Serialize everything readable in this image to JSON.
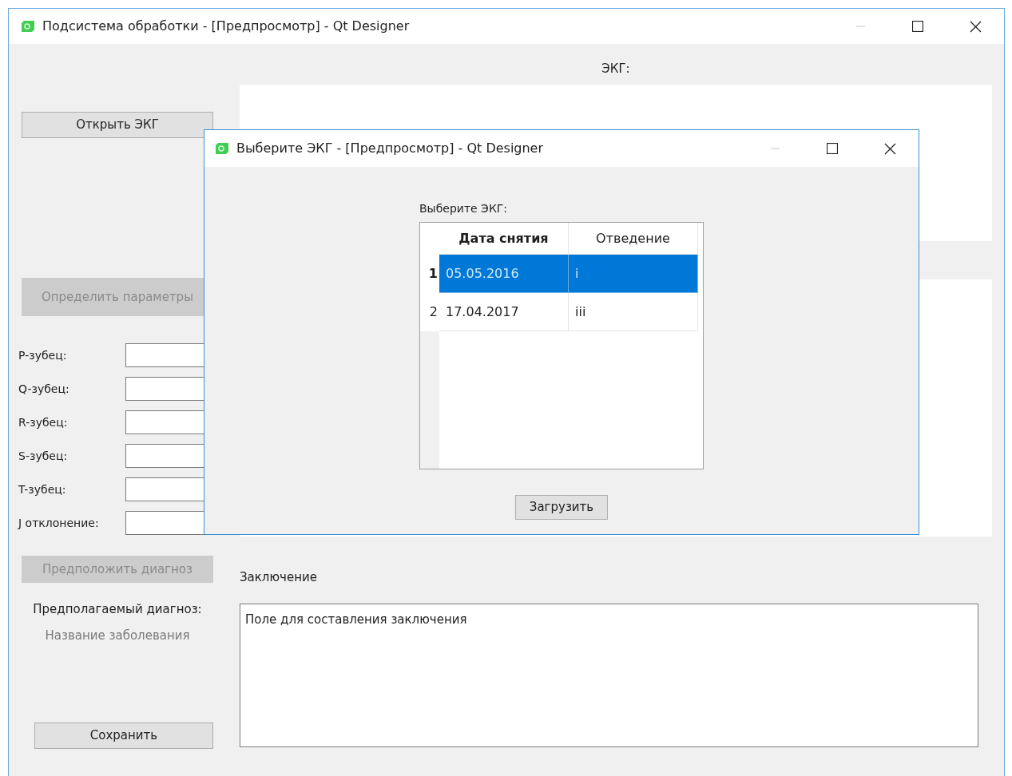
{
  "main_window": {
    "title": "Подсистема обработки - [Предпросмотр] - Qt Designer"
  },
  "left_panel": {
    "open_button": {
      "label": "Открыть ЭКГ",
      "disabled": false
    },
    "params_button": {
      "label": "Определить параметры",
      "disabled": true
    },
    "fields": [
      {
        "label": "P-зубец:"
      },
      {
        "label": "Q-зубец:"
      },
      {
        "label": "R-зубец:"
      },
      {
        "label": "S-зубец:"
      },
      {
        "label": "T-зубец:"
      },
      {
        "label": "J отклонение:"
      }
    ],
    "diagnose_button": {
      "label": "Предположить диагноз",
      "disabled": true
    },
    "diagnosis_label": "Предполагаемый диагноз:",
    "diagnosis_value": "Название заболевания",
    "save_button": {
      "label": "Сохранить",
      "disabled": false
    }
  },
  "right_panel": {
    "ecg_title": "ЭКГ:",
    "conclusion_label": "Заключение",
    "conclusion_value": "Поле для составления заключения"
  },
  "dialog": {
    "title": "Выберите ЭКГ - [Предпросмотр] - Qt Designer",
    "label": "Выберите ЭКГ:",
    "table": {
      "columns": [
        "Дата снятия",
        "Отведение"
      ],
      "rows": [
        {
          "header": "1",
          "cells": [
            "05.05.2016",
            "i"
          ],
          "selected": true
        },
        {
          "header": "2",
          "cells": [
            "17.04.2017",
            "iii"
          ],
          "selected": false
        }
      ]
    },
    "load_button": {
      "label": "Загрузить",
      "disabled": false
    }
  }
}
